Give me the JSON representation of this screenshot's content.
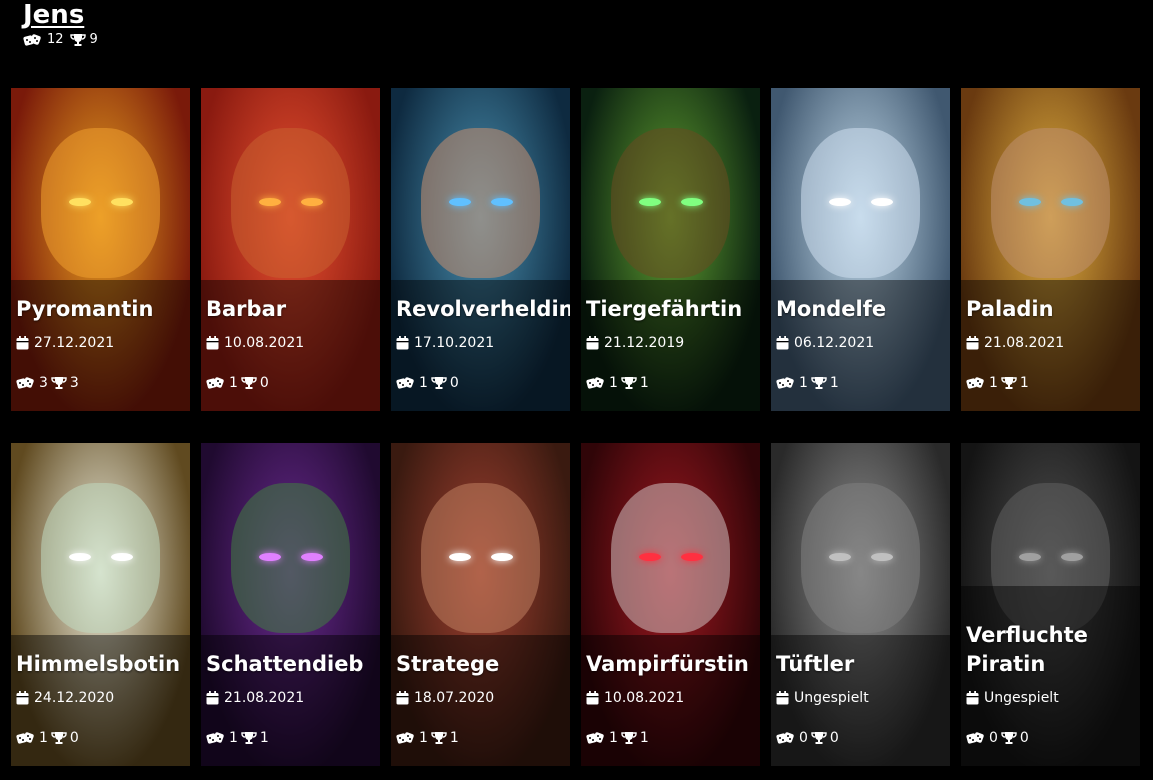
{
  "player": {
    "name": "Jens",
    "games": "12",
    "wins": "9"
  },
  "characters": [
    {
      "name": "Pyromantin",
      "date": "27.12.2021",
      "games": "3",
      "wins": "3",
      "bg": [
        "#7a1a0a",
        "#e8a020"
      ],
      "face": "#f0a030",
      "eye": "#ffe060"
    },
    {
      "name": "Barbar",
      "date": "10.08.2021",
      "games": "1",
      "wins": "0",
      "bg": [
        "#8a1a10",
        "#e85030"
      ],
      "face": "#c86030",
      "eye": "#ffb040"
    },
    {
      "name": "Revolverheldin",
      "date": "17.10.2021",
      "games": "1",
      "wins": "0",
      "bg": [
        "#0e2a40",
        "#4a90b0"
      ],
      "face": "#c89070",
      "eye": "#60c0ff"
    },
    {
      "name": "Tiergefährtin",
      "date": "21.12.2019",
      "games": "1",
      "wins": "1",
      "bg": [
        "#0a2010",
        "#60a030"
      ],
      "face": "#6a4a20",
      "eye": "#80ff80"
    },
    {
      "name": "Mondelfe",
      "date": "06.12.2021",
      "games": "1",
      "wins": "1",
      "bg": [
        "#405870",
        "#c0d8e8"
      ],
      "face": "#d0e0f0",
      "eye": "#ffffff"
    },
    {
      "name": "Paladin",
      "date": "21.08.2021",
      "games": "1",
      "wins": "1",
      "bg": [
        "#6a3a10",
        "#e0b040"
      ],
      "face": "#c09070",
      "eye": "#70c0e0"
    },
    {
      "name": "Himmelsbotin",
      "date": "24.12.2020",
      "games": "1",
      "wins": "0",
      "bg": [
        "#604a20",
        "#f0f0e0"
      ],
      "face": "#c0d8c0",
      "eye": "#ffffff"
    },
    {
      "name": "Schattendieb",
      "date": "21.08.2021",
      "games": "1",
      "wins": "1",
      "bg": [
        "#200a30",
        "#6a2a90"
      ],
      "face": "#408040",
      "eye": "#e080ff"
    },
    {
      "name": "Stratege",
      "date": "18.07.2020",
      "games": "1",
      "wins": "1",
      "bg": [
        "#3a1a10",
        "#a04030"
      ],
      "face": "#c08060",
      "eye": "#ffffff"
    },
    {
      "name": "Vampirfürstin",
      "date": "10.08.2021",
      "games": "1",
      "wins": "1",
      "bg": [
        "#300508",
        "#a01820"
      ],
      "face": "#d0c0c0",
      "eye": "#ff3040"
    },
    {
      "name": "Tüftler",
      "date": "Ungespielt",
      "games": "0",
      "wins": "0",
      "bg": [
        "#2a2a2a",
        "#909090"
      ],
      "face": "#808080",
      "eye": "#c0c0c0"
    },
    {
      "name": "Verfluchte Piratin",
      "date": "Ungespielt",
      "games": "0",
      "wins": "0",
      "bg": [
        "#141414",
        "#505050"
      ],
      "face": "#606060",
      "eye": "#a0a0a0"
    }
  ]
}
